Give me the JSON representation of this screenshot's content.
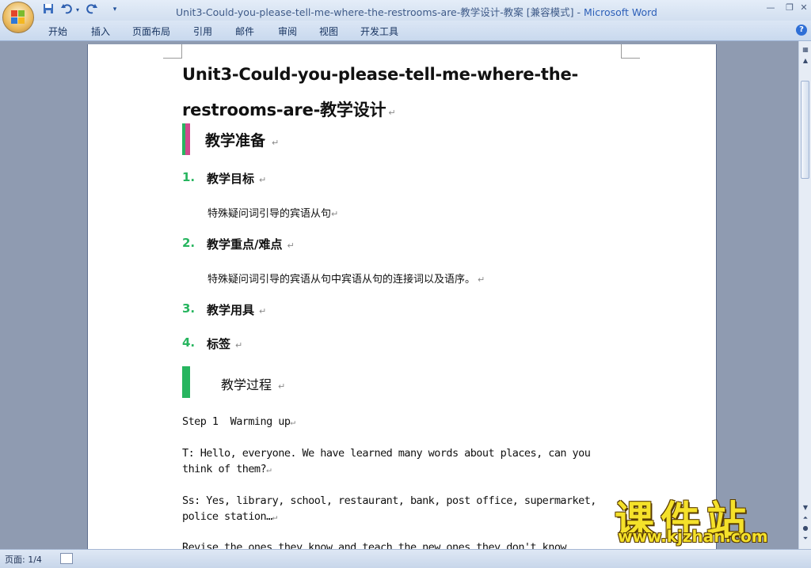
{
  "window": {
    "doc_title": "Unit3-Could-you-please-tell-me-where-the-restrooms-are-教学设计-教案 [兼容模式]",
    "separator": " - ",
    "app_name": "Microsoft Word"
  },
  "quick_access": {
    "save_icon": "save-icon",
    "undo_icon": "undo-icon",
    "redo_icon": "redo-icon",
    "customize_icon": "customize-icon"
  },
  "ribbon": {
    "tabs": [
      "开始",
      "插入",
      "页面布局",
      "引用",
      "邮件",
      "审阅",
      "视图",
      "开发工具"
    ]
  },
  "document": {
    "title_line1": "Unit3-Could-you-please-tell-me-where-the-",
    "title_line2": "restrooms-are-教学设计",
    "section1": "教学准备",
    "items": [
      {
        "num": "1.",
        "label": "教学目标",
        "text": "特殊疑问词引导的宾语从句"
      },
      {
        "num": "2.",
        "label": "教学重点/难点",
        "text": "特殊疑问词引导的宾语从句中宾语从句的连接词以及语序。"
      },
      {
        "num": "3.",
        "label": "教学用具",
        "text": ""
      },
      {
        "num": "4.",
        "label": "标签",
        "text": ""
      }
    ],
    "section2": "教学过程",
    "step1": "Step 1  Warming up",
    "t_line1": "T: Hello, everyone. We have learned many words about places, can you",
    "t_line2": "think of them?",
    "ss_line1": "Ss: Yes, library, school, restaurant, bank, post office, supermarket,",
    "ss_line2": "police station…",
    "cut_line": "Revise the ones they know and teach the new ones they don't know."
  },
  "status": {
    "page": "页面: 1/4"
  },
  "watermark": {
    "text": "课件站",
    "url": "www.kjzhan.com"
  },
  "colors": {
    "accent_green": "#27b55f",
    "accent_pink": "#d04a8d"
  }
}
